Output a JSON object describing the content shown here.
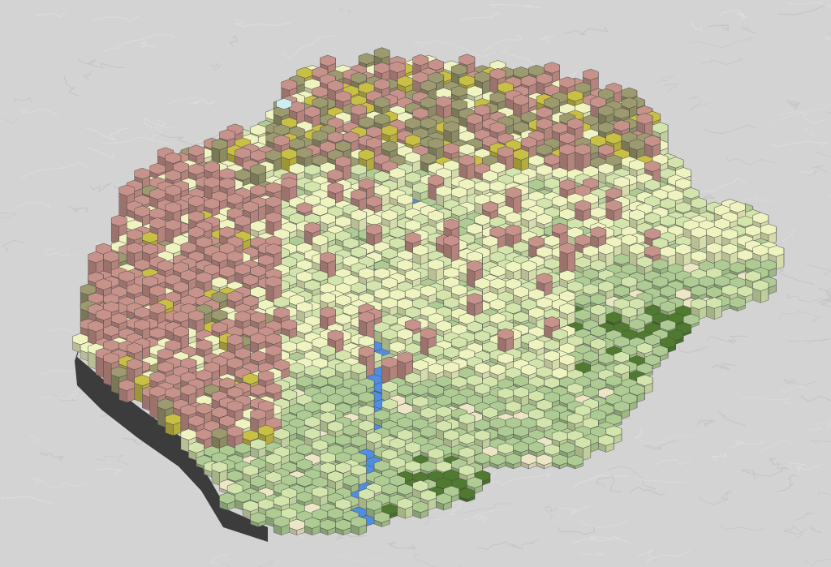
{
  "map": {
    "view": "3d-hexbin-extrusion",
    "basemap": "gray-terrain",
    "colors": {
      "background": "#d3d3d3",
      "terrain_line": "#c6c6c6",
      "wall_dark": "#3c3c3c",
      "edge": "#4a4a4a",
      "rose": "#c7928a",
      "olive": "#9c9a6e",
      "mustard": "#c9bf45",
      "pale_yellow": "#eef3bf",
      "light_green": "#d3e5ad",
      "sage": "#aecb94",
      "dark_green": "#4f7a2f",
      "water": "#4f8ee0",
      "beige": "#ece6c6",
      "cyan": "#cceeee"
    },
    "zones": [
      {
        "name": "rose",
        "weight": "northwest-and-west",
        "height": "high"
      },
      {
        "name": "olive",
        "weight": "north",
        "height": "high"
      },
      {
        "name": "mustard",
        "weight": "north",
        "height": "high"
      },
      {
        "name": "pale_yellow",
        "weight": "center-and-northeast",
        "height": "medium"
      },
      {
        "name": "light_green",
        "weight": "center",
        "height": "medium"
      },
      {
        "name": "sage",
        "weight": "south-and-east",
        "height": "low"
      },
      {
        "name": "dark_green",
        "weight": "southeast-spots",
        "height": "low"
      },
      {
        "name": "water",
        "weight": "stream-south-center",
        "height": "low"
      },
      {
        "name": "beige",
        "weight": "scattered-south",
        "height": "low"
      }
    ]
  }
}
